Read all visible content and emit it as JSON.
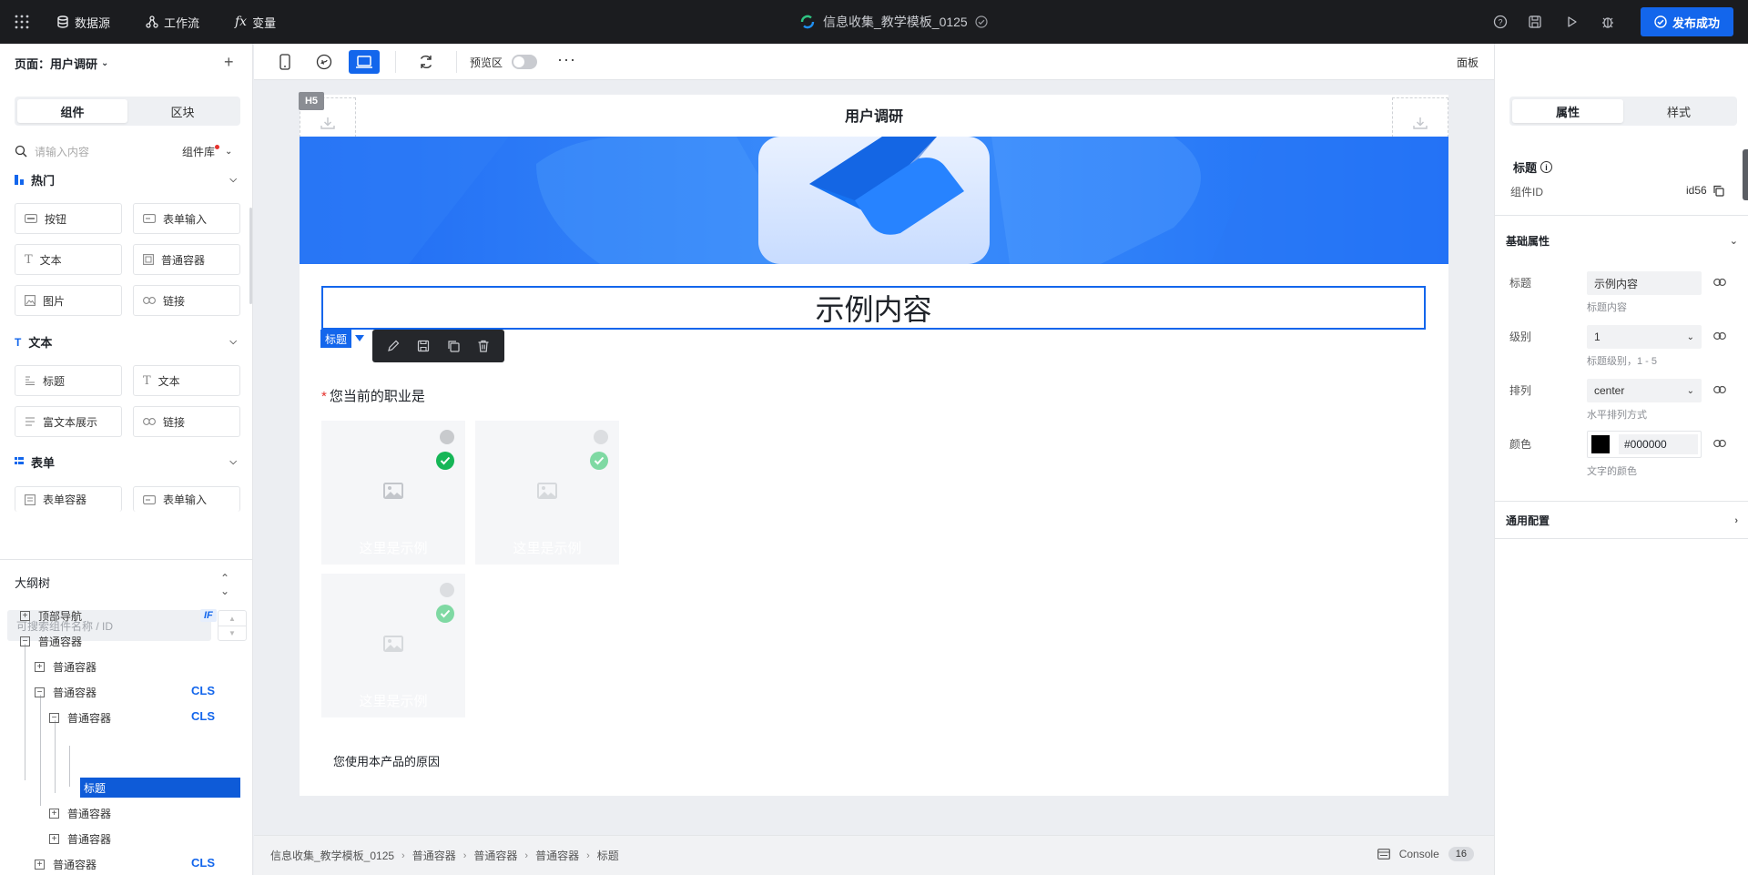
{
  "topbar": {
    "nav": [
      {
        "label": "数据源",
        "icon": "database-icon"
      },
      {
        "label": "工作流",
        "icon": "workflow-icon"
      },
      {
        "label": "变量",
        "icon": "fx-icon"
      }
    ],
    "title": "信息收集_教学模板_0125",
    "publish_label": "发布成功",
    "colors": {
      "accent": "#1366ec",
      "bar": "#1b1c1f"
    }
  },
  "left": {
    "page_selector": "页面：用户调研",
    "tabs": [
      "组件",
      "区块"
    ],
    "search_placeholder": "请输入内容",
    "library_label": "组件库",
    "sections": [
      {
        "title": "热门",
        "items": [
          "按钮",
          "表单输入",
          "文本",
          "普通容器",
          "图片",
          "链接"
        ]
      },
      {
        "title": "文本",
        "items": [
          "标题",
          "文本",
          "富文本展示",
          "链接"
        ]
      },
      {
        "title": "表单",
        "items": [
          "表单容器",
          "表单输入"
        ]
      }
    ],
    "outline": {
      "title": "大纲树",
      "search_placeholder": "可搜索组件名称 / ID",
      "nodes": [
        {
          "label": "顶部导航",
          "tag": "IF"
        },
        {
          "label": "普通容器",
          "tag": ""
        },
        {
          "label": "普通容器",
          "tag": ""
        },
        {
          "label": "普通容器",
          "tag": "CLS"
        },
        {
          "label": "普通容器",
          "tag": "CLS"
        },
        {
          "label": "标题",
          "tag": ""
        },
        {
          "label": "普通容器",
          "tag": ""
        },
        {
          "label": "普通容器",
          "tag": ""
        },
        {
          "label": "普通容器",
          "tag": "CLS"
        }
      ]
    }
  },
  "toolbar": {
    "preview_label": "预览区",
    "panel_label": "面板",
    "more": "···"
  },
  "canvas": {
    "badge": "H5",
    "page_title": "用户调研",
    "selected_heading": "示例内容",
    "selected_label": "标题",
    "question": "您当前的职业是",
    "required_mark": "*",
    "option_caption": "这里是示例",
    "second_question": "您使用本产品的原因"
  },
  "breadcrumb": [
    "信息收集_教学模板_0125",
    "普通容器",
    "普通容器",
    "普通容器",
    "标题"
  ],
  "console": {
    "label": "Console",
    "count": "16"
  },
  "right": {
    "tabs": [
      "属性",
      "样式"
    ],
    "component_title": "标题",
    "id_label": "组件ID",
    "id_value": "id56",
    "group_basic": "基础属性",
    "fields": [
      {
        "label": "标题",
        "value": "示例内容",
        "help": "标题内容"
      },
      {
        "label": "级别",
        "value": "1",
        "help": "标题级别，1 - 5"
      },
      {
        "label": "排列",
        "value": "center",
        "help": "水平排列方式"
      },
      {
        "label": "颜色",
        "value": "#000000",
        "help": "文字的颜色"
      }
    ],
    "group_general": "通用配置"
  }
}
